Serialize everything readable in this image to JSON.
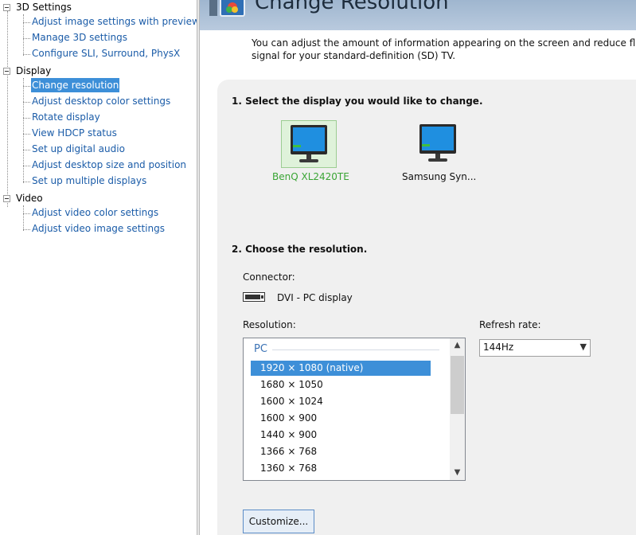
{
  "tree": {
    "categories": [
      {
        "label": "3D Settings",
        "items": [
          {
            "label": "Adjust image settings with preview"
          },
          {
            "label": "Manage 3D settings"
          },
          {
            "label": "Configure SLI, Surround, PhysX"
          }
        ]
      },
      {
        "label": "Display",
        "items": [
          {
            "label": "Change resolution",
            "selected": true
          },
          {
            "label": "Adjust desktop color settings"
          },
          {
            "label": "Rotate display"
          },
          {
            "label": "View HDCP status"
          },
          {
            "label": "Set up digital audio"
          },
          {
            "label": "Adjust desktop size and position"
          },
          {
            "label": "Set up multiple displays"
          }
        ]
      },
      {
        "label": "Video",
        "items": [
          {
            "label": "Adjust video color settings"
          },
          {
            "label": "Adjust video image settings"
          }
        ]
      }
    ]
  },
  "page": {
    "title": "Change Resolution",
    "description_line1": "You can adjust the amount of information appearing on the screen and reduce flick",
    "description_line2": "signal for your standard-definition (SD) TV."
  },
  "step1": {
    "heading": "1. Select the display you would like to change.",
    "displays": [
      {
        "label": "BenQ XL2420TE",
        "selected": true
      },
      {
        "label": "Samsung Syn..."
      }
    ]
  },
  "step2": {
    "heading": "2. Choose the resolution.",
    "connector_label": "Connector:",
    "connector_value": "DVI - PC display",
    "resolution_label": "Resolution:",
    "refresh_label": "Refresh rate:",
    "refresh_value": "144Hz",
    "list_group": "PC",
    "resolutions": [
      "1920 × 1080 (native)",
      "1680 × 1050",
      "1600 × 1024",
      "1600 × 900",
      "1440 × 900",
      "1366 × 768",
      "1360 × 768"
    ],
    "selected_index": 0,
    "customize_label": "Customize..."
  },
  "colors": {
    "selection": "#3d8fd8",
    "link": "#1b5ca8",
    "display_selected_label": "#3aa535",
    "banner": "#a9bed6"
  }
}
